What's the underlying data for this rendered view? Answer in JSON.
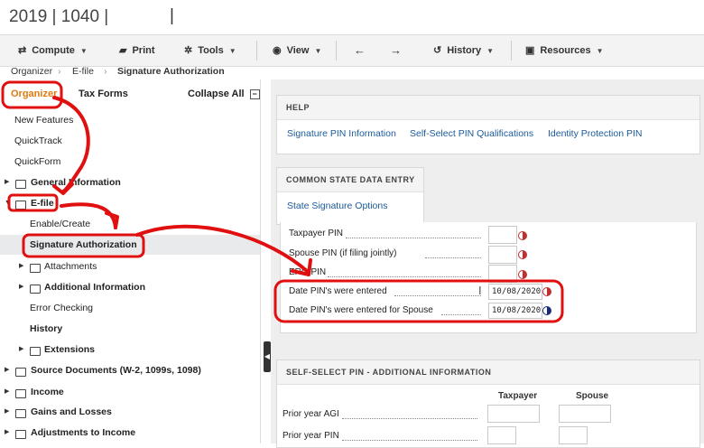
{
  "header": {
    "app_title": "2019 | 1040 |",
    "title_cursor": "|"
  },
  "toolbar": {
    "compute": "Compute",
    "print": "Print",
    "tools": "Tools",
    "view": "View",
    "history": "History",
    "resources": "Resources"
  },
  "breadcrumb": {
    "items": [
      "Organizer",
      "E-file",
      "Signature Authorization"
    ]
  },
  "sidebar": {
    "tab_organizer": "Organizer",
    "tab_taxforms": "Tax Forms",
    "collapse_all": "Collapse All",
    "items": [
      {
        "label": "New Features"
      },
      {
        "label": "QuickTrack"
      },
      {
        "label": "QuickForm"
      },
      {
        "label": "General Information"
      },
      {
        "label": "E-file"
      },
      {
        "label": "Enable/Create"
      },
      {
        "label": "Signature Authorization"
      },
      {
        "label": "Attachments"
      },
      {
        "label": "Additional Information"
      },
      {
        "label": "Error Checking"
      },
      {
        "label": "History"
      },
      {
        "label": "Extensions"
      },
      {
        "label": "Source Documents (W-2, 1099s, 1098)"
      },
      {
        "label": "Income"
      },
      {
        "label": "Gains and Losses"
      },
      {
        "label": "Adjustments to Income"
      }
    ]
  },
  "help": {
    "heading": "HELP",
    "links": [
      "Signature PIN Information",
      "Self-Select PIN Qualifications",
      "Identity Protection PIN"
    ]
  },
  "common_state": {
    "heading": "COMMON STATE DATA ENTRY",
    "link": "State Signature Options"
  },
  "pin_fields": {
    "taxpayer_pin": "Taxpayer PIN",
    "spouse_pin": "Spouse PIN (if filing jointly)",
    "ero_pin": "ERO PIN",
    "date_entered": "Date PIN's were entered",
    "date_entered_value": "10/08/2020",
    "date_spouse": "Date PIN's were entered for Spouse",
    "date_spouse_value": "10/08/2020"
  },
  "self_select": {
    "heading": "SELF-SELECT PIN - ADDITIONAL INFORMATION",
    "col_taxpayer": "Taxpayer",
    "col_spouse": "Spouse",
    "prior_agi": "Prior year AGI",
    "prior_pin": "Prior year PIN"
  },
  "colors": {
    "accent_orange": "#e07a10",
    "annotation_red": "#e01010",
    "link_blue": "#1a5a9a"
  }
}
